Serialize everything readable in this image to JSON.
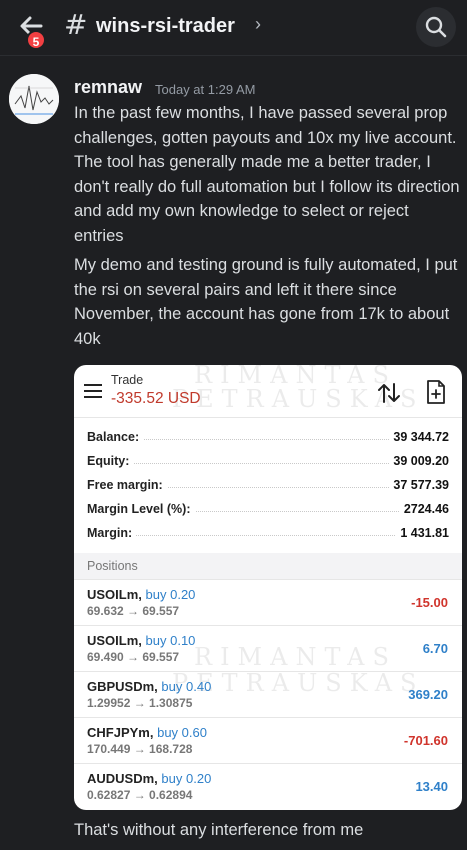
{
  "header": {
    "back_badge": "5",
    "hash": "#",
    "channel_name": "wins-rsi-trader",
    "chevron": "›"
  },
  "message": {
    "author": "remnaw",
    "timestamp": "Today at 1:29 AM",
    "paragraph1": "In the past few months, I have  passed several prop challenges, gotten payouts and 10x my live account. The tool has generally made me a better trader, I don't really do full automation but I follow its direction and add my own knowledge to select or reject entries",
    "paragraph2": "My demo and testing ground is fully automated, I put the rsi on several pairs and left it there since November, the account has gone from 17k to about 40k",
    "followup": "That's without any interference from me"
  },
  "screenshot": {
    "trade_label": "Trade",
    "trade_value": "-335.52 USD",
    "watermark_line1": "RIMANTAS",
    "watermark_line2": "PETRAUSKAS",
    "account": [
      {
        "label": "Balance:",
        "value": "39 344.72"
      },
      {
        "label": "Equity:",
        "value": "39 009.20"
      },
      {
        "label": "Free margin:",
        "value": "37 577.39"
      },
      {
        "label": "Margin Level (%):",
        "value": "2724.46"
      },
      {
        "label": "Margin:",
        "value": "1 431.81"
      }
    ],
    "positions_title": "Positions",
    "positions": [
      {
        "symbol": "USOILm,",
        "side": "buy 0.20",
        "prices": "69.632 → 69.557",
        "pl": "-15.00",
        "pl_color": "neg"
      },
      {
        "symbol": "USOILm,",
        "side": "buy 0.10",
        "prices": "69.490 → 69.557",
        "pl": "6.70",
        "pl_color": "pos"
      },
      {
        "symbol": "GBPUSDm,",
        "side": "buy 0.40",
        "prices": "1.29952 → 1.30875",
        "pl": "369.20",
        "pl_color": "pos"
      },
      {
        "symbol": "CHFJPYm,",
        "side": "buy 0.60",
        "prices": "170.449 → 168.728",
        "pl": "-701.60",
        "pl_color": "neg"
      },
      {
        "symbol": "AUDUSDm,",
        "side": "buy 0.20",
        "prices": "0.62827 → 0.62894",
        "pl": "13.40",
        "pl_color": "pos"
      }
    ]
  },
  "icons": {
    "back": "back-arrow-icon",
    "search": "search-icon",
    "menu": "hamburger-menu-icon",
    "sort": "sort-arrows-icon",
    "add": "add-document-icon",
    "avatar": "chart-avatar-image"
  },
  "colors": {
    "background": "#1e1f22",
    "badge": "#f23f42",
    "negative": "#d0342c",
    "positive": "#2f80c9"
  }
}
